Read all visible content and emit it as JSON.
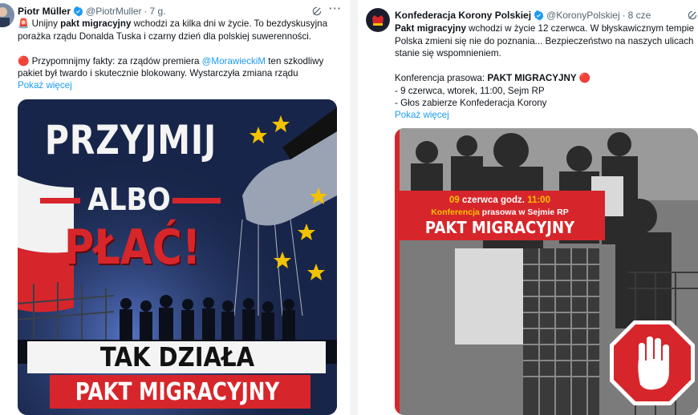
{
  "tweet1": {
    "author_name": "Piotr Müller",
    "handle": "@PiotrMuller",
    "separator": "·",
    "time": "7 g.",
    "text": {
      "line1_emoji": "🚨",
      "line1_a": "Unijny ",
      "line1_b": "pakt migracyjny",
      "line1_c": " wchodzi za kilka dni w życie. To bezdyskusyjna",
      "line2": "porażka rządu Donalda Tuska i czarny dzień dla polskiej suwerenności.",
      "line3_emoji": "🔴",
      "line3_a": "Przypomnijmy fakty: za rządów premiera ",
      "line3_mention": "@MorawieckiM",
      "line3_b": " ten szkodliwy",
      "line4": "pakiet był twardo i skutecznie blokowany. Wystarczyła zmiana rządu"
    },
    "show_more": "Pokaż więcej",
    "image": {
      "title_line1": "PRZYJMIJ",
      "title_line2": "ALBO",
      "title_line3": "PŁAĆ!",
      "banner_line1": "TAK DZIAŁA",
      "banner_line2": "PAKT MIGRACYJNY"
    }
  },
  "tweet2": {
    "author_name": "Konfederacja Korony Polskiej",
    "handle": "@KoronyPolskiej",
    "separator": "·",
    "time": "8 cze",
    "text": {
      "line1_b": "Pakt migracyjny",
      "line1_c": " wchodzi w życie 12 czerwca. W błyskawicznym tempie",
      "line2": "Polska zmieni się nie do poznania... Bezpieczeństwo na naszych ulicach",
      "line3": "stanie się wspomnieniem.",
      "line4_a": "Konferencja prasowa: ",
      "line4_b": "PAKT MIGRACYJNY",
      "line4_emoji": "🔴",
      "line5": "- 9 czerwca, wtorek, 11:00, Sejm RP",
      "line6": "- Głos zabierze Konfederacja Korony"
    },
    "show_more": "Pokaż więcej",
    "image": {
      "date_prefix": "09",
      "date_mid": " czerwca godz. ",
      "date_time": "11:00",
      "conf_word": "Konferencja",
      "conf_rest": " prasowa w Sejmie RP",
      "title": "PAKT MIGRACYJNY"
    }
  },
  "colors": {
    "link": "#1d9bf0",
    "verified": "#1d9bf0",
    "red": "#d7262b",
    "poster_bg": "#16223f"
  },
  "icons": {
    "grok": "grok-icon",
    "more": "more-icon",
    "verified": "verified-badge-icon",
    "siren": "siren-icon",
    "red_circle": "red-circle-icon",
    "stop_hand": "stop-hand-icon"
  }
}
